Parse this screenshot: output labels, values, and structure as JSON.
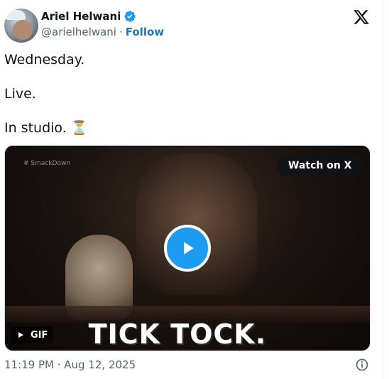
{
  "author": {
    "name": "Ariel Helwani",
    "handle": "@arielhelwani",
    "separator": "·",
    "follow_label": "Follow",
    "verified_color": "#1d9bf0"
  },
  "tweet": {
    "lines": [
      "Wednesday.",
      "Live.",
      "In studio. ⏳"
    ]
  },
  "media": {
    "watermark": "# SmackDown",
    "watch_label": "Watch on X",
    "gif_label": "GIF",
    "caption": "TICK TOCK.",
    "play_color": "#1d9bf0"
  },
  "footer": {
    "timestamp": "11:19 PM · Aug 12, 2025"
  },
  "icons": {
    "brand": "x-logo-icon",
    "verified": "verified-badge-icon",
    "play": "play-icon",
    "gif_play": "small-play-icon",
    "info": "info-icon"
  }
}
